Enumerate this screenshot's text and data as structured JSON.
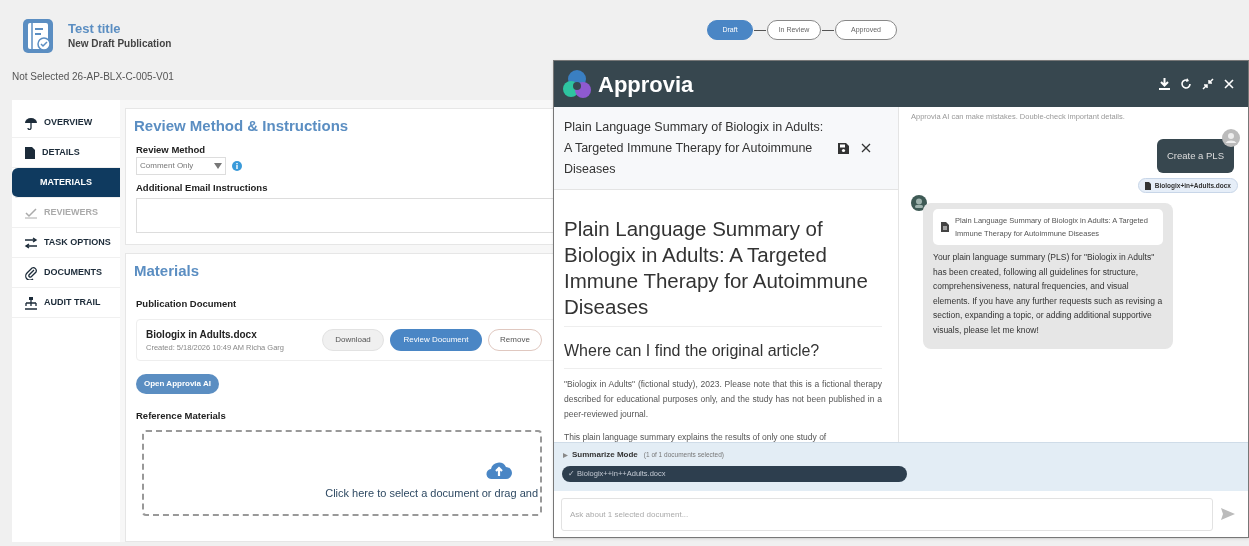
{
  "header": {
    "title": "Test title",
    "subtitle": "New Draft Publication",
    "status_line": "Not Selected 26-AP-BLX-C-005-V01"
  },
  "stepper": [
    {
      "label": "Draft",
      "selected": true
    },
    {
      "label": "In Review",
      "selected": false
    },
    {
      "label": "Approved",
      "selected": false
    }
  ],
  "sidebar": {
    "items": [
      {
        "label": "OVERVIEW",
        "selected": false,
        "disabled": false
      },
      {
        "label": "DETAILS",
        "selected": false,
        "disabled": false
      },
      {
        "label": "MATERIALS",
        "selected": true,
        "disabled": false
      },
      {
        "label": "REVIEWERS",
        "selected": false,
        "disabled": true
      },
      {
        "label": "TASK OPTIONS",
        "selected": false,
        "disabled": false
      },
      {
        "label": "DOCUMENTS",
        "selected": false,
        "disabled": false
      },
      {
        "label": "AUDIT TRAIL",
        "selected": false,
        "disabled": false
      }
    ]
  },
  "review_section": {
    "heading": "Review Method & Instructions",
    "method_label": "Review Method",
    "method_value": "Comment Only",
    "email_label": "Additional Email Instructions"
  },
  "materials_section": {
    "heading": "Materials",
    "publication_label": "Publication Document",
    "document": {
      "name": "Biologix in Adults.docx",
      "meta": "Created: 5/18/2026 10:49 AM Richa Garg",
      "buttons": [
        {
          "label": "Download",
          "kind": "secondary"
        },
        {
          "label": "Review Document",
          "kind": "primary"
        },
        {
          "label": "Remove",
          "kind": "danger"
        }
      ]
    },
    "open_ai_button": "Open Approvia AI",
    "reference_label": "Reference Materials",
    "dropzone_text": "Click here to select a document or drag and"
  },
  "assistant": {
    "brand": "Approvia",
    "document_panel": {
      "title": "Plain Language Summary of Biologix in Adults: A Targeted Immune Therapy for Autoimmune Diseases",
      "heading": "Plain Language Summary of Biologix in Adults: A Targeted Immune Therapy for Autoimmune Diseases",
      "subheading": "Where can I find the original article?",
      "paragraphs": [
        "\"Biologix in Adults\" (fictional study), 2023. Please note that this is a fictional therapy described for educational purposes only, and the study has not been published in a peer-reviewed journal.",
        "This plain language summary explains the results of only one study of"
      ]
    },
    "disclaimer": "Approvia AI can make mistakes. Double-check important details.",
    "messages": [
      {
        "kind": "user",
        "text": "Create a PLS",
        "attachment": "Biologix+in+Adults.docx"
      },
      {
        "kind": "bot",
        "document": "Plain Language Summary of Biologix in Adults: A Targeted Immune Therapy for Autoimmune Diseases",
        "text": "Your plain language summary (PLS) for \"Biologix in Adults\" has been created, following all guidelines for structure, comprehensiveness, natural frequencies, and visual elements. If you have any further requests such as revising a section, expanding a topic, or adding additional supportive visuals, please let me know!"
      }
    ],
    "mode": {
      "label": "Summarize Mode",
      "count": "(1 of 1 documents selected)",
      "chips": [
        {
          "label": "✓ Biologix++in++Adults.docx",
          "selected": true
        }
      ]
    },
    "input": {
      "placeholder": "Ask about 1 selected document..."
    }
  }
}
